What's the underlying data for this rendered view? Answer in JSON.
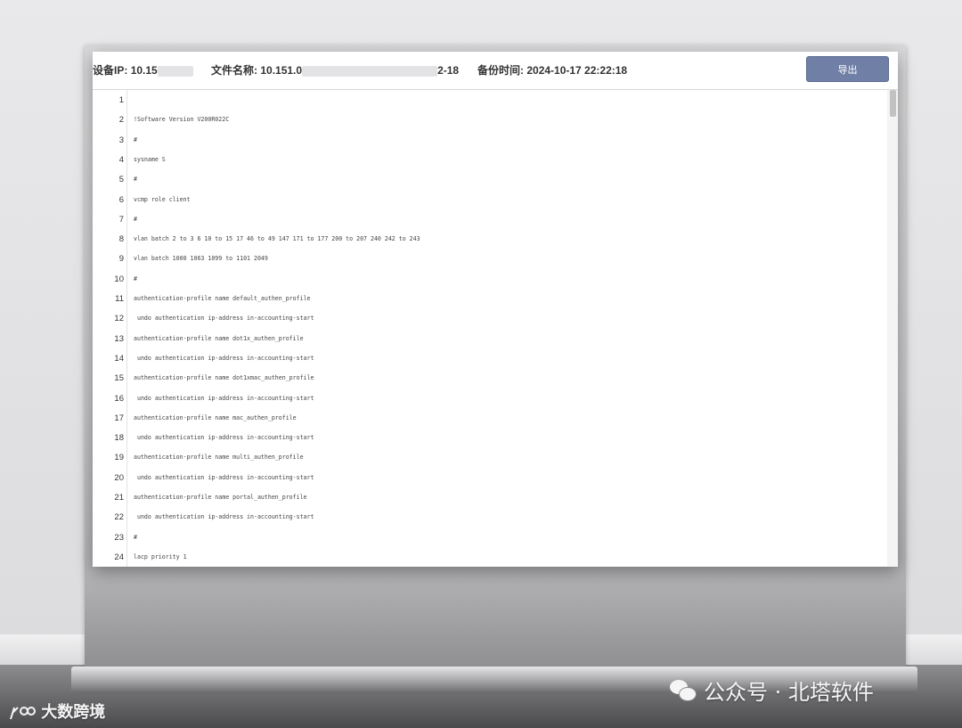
{
  "header": {
    "device_ip_label": "设备IP:",
    "device_ip_value": "10.15",
    "file_name_label": "文件名称:",
    "file_name_value": "10.151.0",
    "file_name_suffix": "2-18",
    "backup_time_label": "备份时间:",
    "backup_time_value": "2024-10-17 22:22:18",
    "export_label": "导出"
  },
  "lines": [
    {
      "n": "1",
      "text": ""
    },
    {
      "n": "2",
      "text": "!Software Version V200R022C"
    },
    {
      "n": "3",
      "text": "#"
    },
    {
      "n": "4",
      "text": "sysname S"
    },
    {
      "n": "5",
      "text": "#"
    },
    {
      "n": "6",
      "text": "vcmp role client"
    },
    {
      "n": "7",
      "text": "#"
    },
    {
      "n": "8",
      "text": "vlan batch 2 to 3 6 10 to 15 17 46 to 49 147 171 to 177 200 to 207 240 242 to 243"
    },
    {
      "n": "9",
      "text": "vlan batch 1000 1063 1099 to 1101 2049"
    },
    {
      "n": "10",
      "text": "#"
    },
    {
      "n": "11",
      "text": "authentication-profile name default_authen_profile"
    },
    {
      "n": "12",
      "text": " undo authentication ip-address in-accounting-start"
    },
    {
      "n": "13",
      "text": "authentication-profile name dot1x_authen_profile"
    },
    {
      "n": "14",
      "text": " undo authentication ip-address in-accounting-start"
    },
    {
      "n": "15",
      "text": "authentication-profile name dot1xmac_authen_profile"
    },
    {
      "n": "16",
      "text": " undo authentication ip-address in-accounting-start"
    },
    {
      "n": "17",
      "text": "authentication-profile name mac_authen_profile"
    },
    {
      "n": "18",
      "text": " undo authentication ip-address in-accounting-start"
    },
    {
      "n": "19",
      "text": "authentication-profile name multi_authen_profile"
    },
    {
      "n": "20",
      "text": " undo authentication ip-address in-accounting-start"
    },
    {
      "n": "21",
      "text": "authentication-profile name portal_authen_profile"
    },
    {
      "n": "22",
      "text": " undo authentication ip-address in-accounting-start"
    },
    {
      "n": "23",
      "text": "#"
    },
    {
      "n": "24",
      "text": "lacp priority 1"
    }
  ],
  "watermark": {
    "left_text": "大数跨境",
    "right_text": "公众号 · 北塔软件"
  },
  "colors": {
    "export_button": "#6f7fa6",
    "text": "#333333"
  }
}
